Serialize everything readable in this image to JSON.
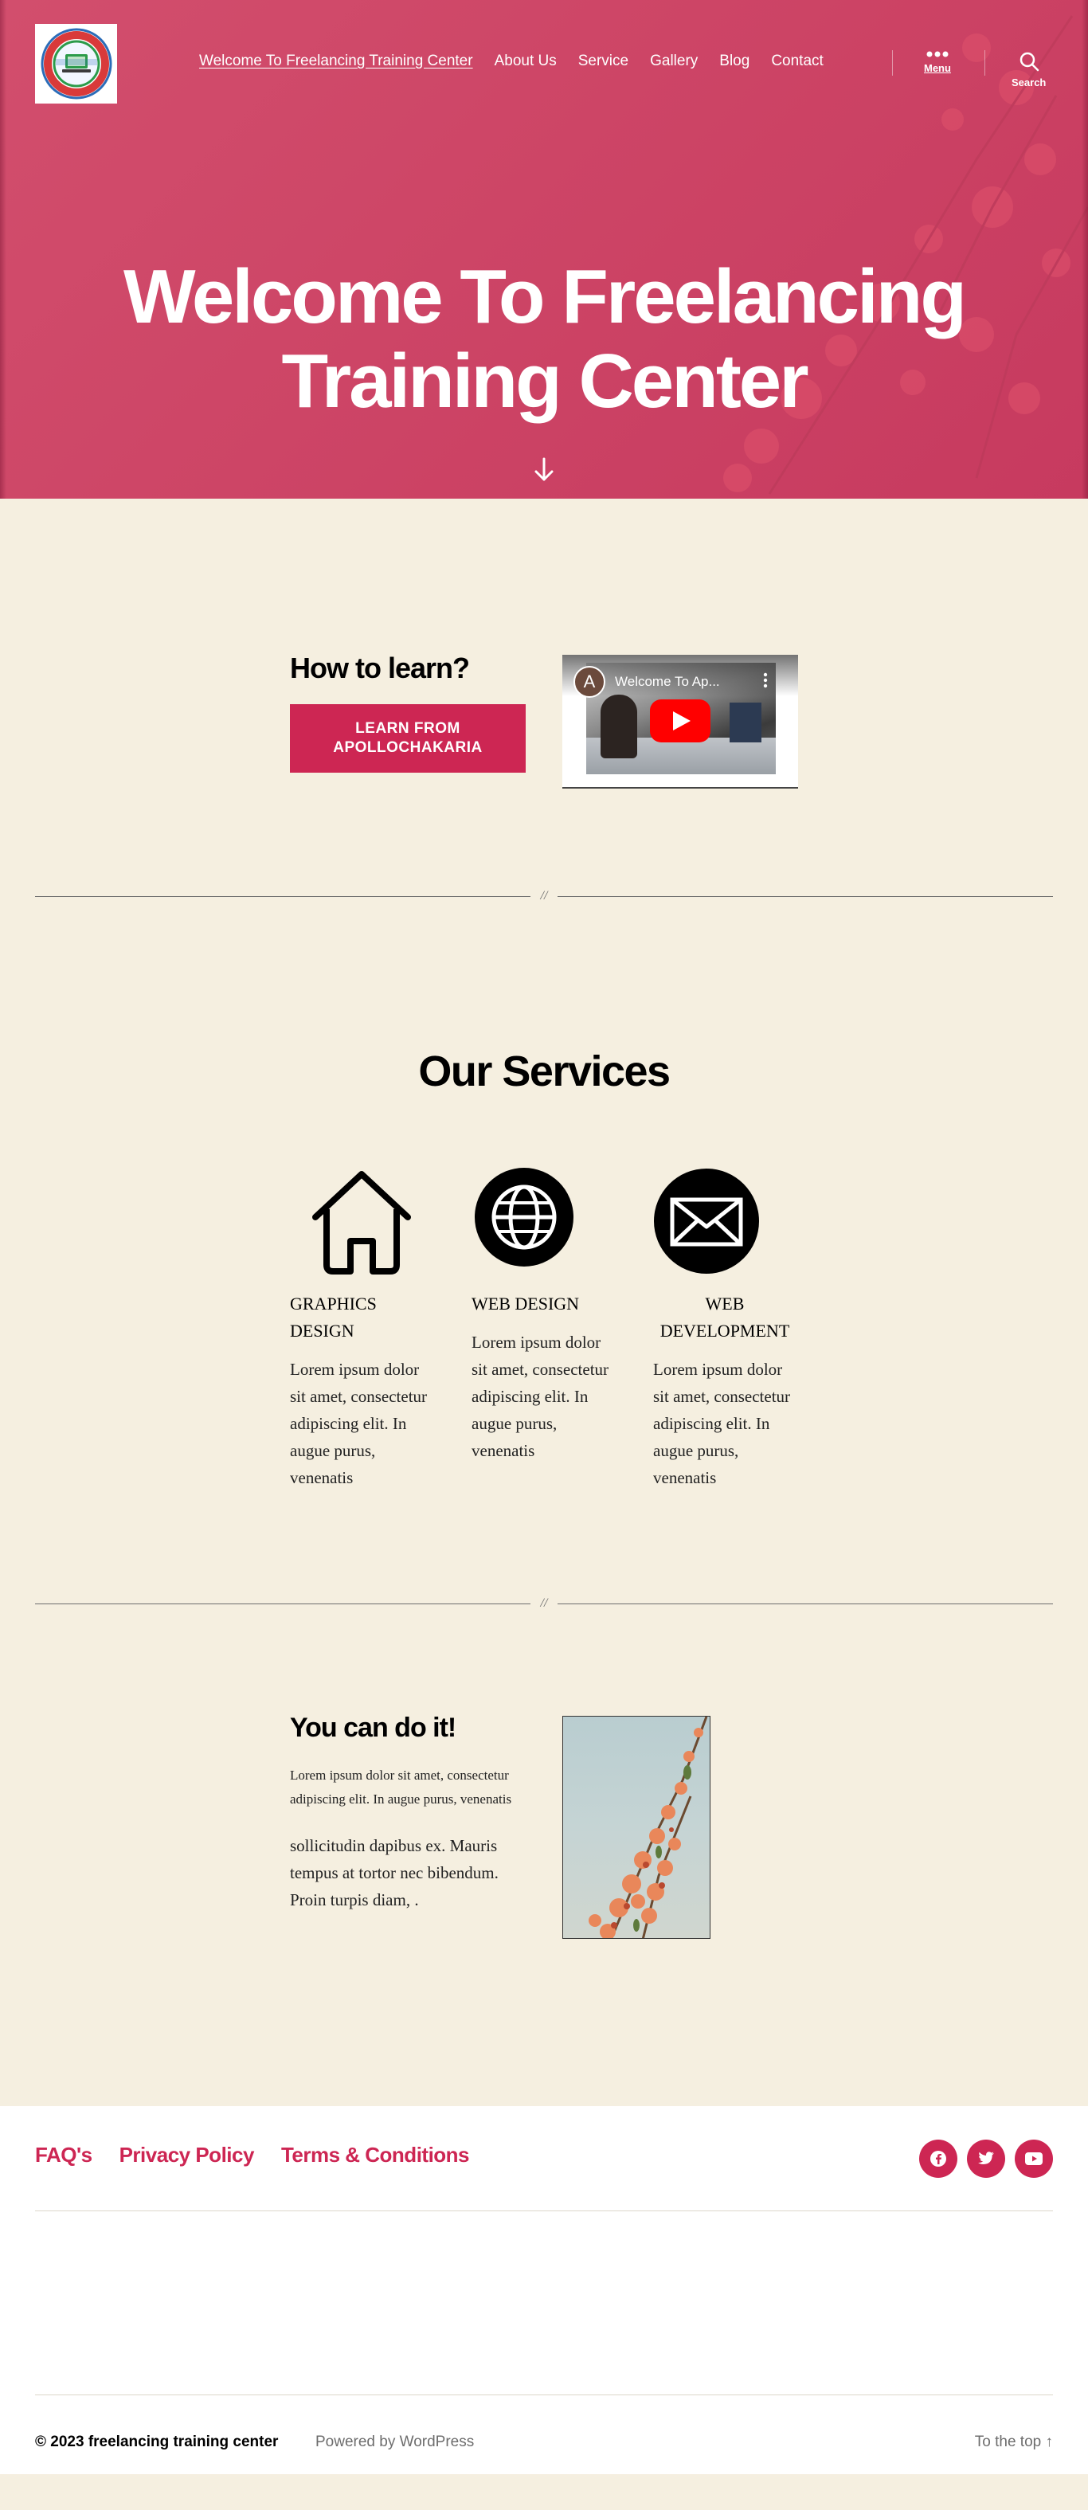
{
  "header": {
    "logo_alt": "Apollo Chakaria Software Solution logo",
    "nav": [
      {
        "label": "Welcome To Freelancing Training Center"
      },
      {
        "label": "About Us"
      },
      {
        "label": "Service"
      },
      {
        "label": "Gallery"
      },
      {
        "label": "Blog"
      },
      {
        "label": "Contact"
      }
    ],
    "menu_label": "Menu",
    "search_label": "Search",
    "menu_icon": "ellipsis-icon",
    "search_icon": "search-icon"
  },
  "hero": {
    "title_line1": "Welcome To Freelancing",
    "title_line2": "Training Center",
    "arrow_icon": "arrow-down-icon",
    "accent": "#cd2653"
  },
  "learn": {
    "heading": "How to learn?",
    "button_line1": "LEARN FROM",
    "button_line2": "APOLLOCHAKARIA",
    "video": {
      "channel_initial": "A",
      "title": "Welcome To Ap...",
      "play_icon": "youtube-play-icon"
    }
  },
  "services": {
    "title": "Our Services",
    "items": [
      {
        "icon": "home-icon",
        "title_line1": "GRAPHICS",
        "title_line2": "DESIGN",
        "text": "Lorem ipsum dolor sit amet, consectetur adipiscing elit. In augue purus, venenatis"
      },
      {
        "icon": "globe-icon",
        "title_line1": "WEB DESIGN",
        "title_line2": "",
        "text": "Lorem ipsum dolor sit amet, consectetur adipiscing elit. In augue purus, venenatis"
      },
      {
        "icon": "envelope-icon",
        "title_line1": "WEB",
        "title_line2": "DEVELOPMENT",
        "text": "Lorem ipsum dolor sit amet, consectetur adipiscing elit. In augue purus, venenatis"
      }
    ]
  },
  "cando": {
    "heading": "You can do it!",
    "small_text": "Lorem ipsum dolor sit amet, consectetur adipiscing elit. In augue purus, venenatis",
    "body_text": "sollicitudin dapibus ex. Mauris tempus at tortor nec bibendum. Proin turpis diam, ."
  },
  "footer": {
    "links": [
      {
        "label": "FAQ's"
      },
      {
        "label": "Privacy Policy"
      },
      {
        "label": "Terms & Conditions"
      }
    ],
    "social": [
      "facebook-icon",
      "twitter-icon",
      "youtube-icon"
    ],
    "copyright": "© 2023 freelancing training center",
    "powered": "Powered by WordPress",
    "to_top": "To the top ↑"
  }
}
